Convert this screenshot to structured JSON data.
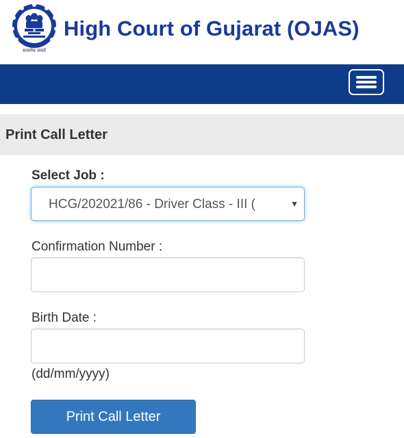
{
  "header": {
    "title": "High Court of Gujarat (OJAS)",
    "logo_icon": "emblem-of-india-icon",
    "logo_motto": "सत्यमेव जयते"
  },
  "navbar": {
    "menu_icon": "hamburger-menu-icon",
    "color": "#0f3c89"
  },
  "panel": {
    "heading": "Print Call Letter"
  },
  "form": {
    "job_label": "Select Job :",
    "job_selected": "HCG/202021/86 - Driver Class - III (",
    "confirmation_label": "Confirmation Number :",
    "confirmation_value": "",
    "birth_label": "Birth Date :",
    "birth_value": "",
    "birth_hint": "(dd/mm/yyyy)",
    "submit_label": "Print Call Letter"
  },
  "colors": {
    "title": "#1a3a9a",
    "button": "#3378bf",
    "panel_heading_bg": "#ebebeb"
  }
}
